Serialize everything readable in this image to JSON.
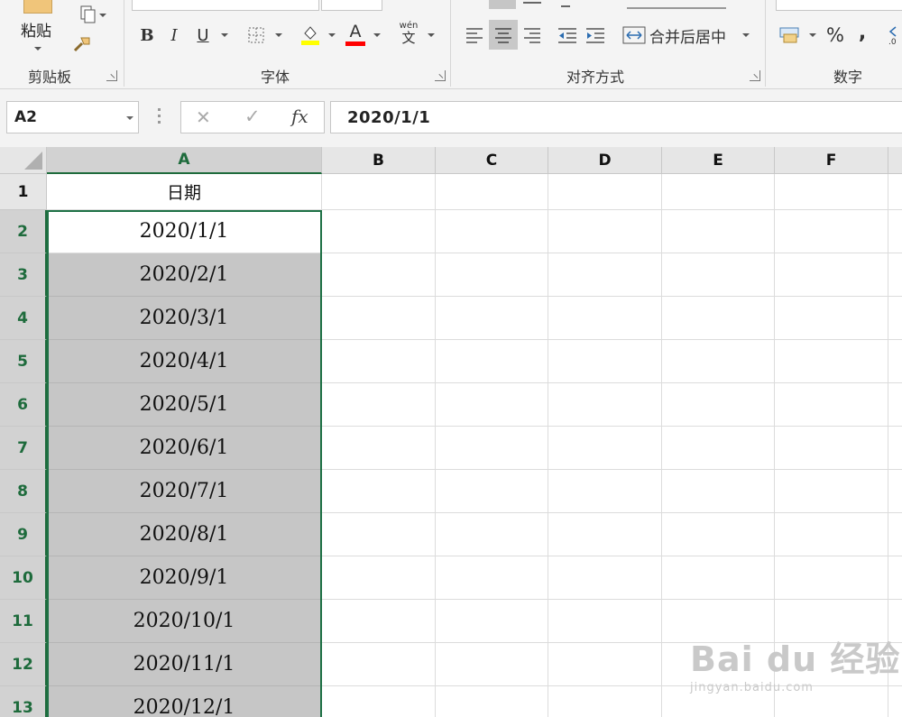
{
  "ribbon": {
    "clipboard": {
      "paste_label": "粘贴",
      "group_label": "剪贴板"
    },
    "font": {
      "group_label": "字体",
      "bold": "B",
      "italic": "I",
      "underline": "U",
      "font_color_letter": "A",
      "phonetic_top": "wén",
      "phonetic_bottom": "文"
    },
    "alignment": {
      "group_label": "对齐方式",
      "merge_center_label": "合并后居中"
    },
    "number": {
      "group_label": "数字",
      "percent": "%",
      "comma": ","
    }
  },
  "formula_bar": {
    "name_box": "A2",
    "fx": "fx",
    "cancel": "✕",
    "enter": "✓",
    "value": "2020/1/1"
  },
  "grid": {
    "columns": [
      "A",
      "B",
      "C",
      "D",
      "E",
      "F"
    ],
    "rows": [
      "1",
      "2",
      "3",
      "4",
      "5",
      "6",
      "7",
      "8",
      "9",
      "10",
      "11",
      "12",
      "13"
    ],
    "column_a": [
      "日期",
      "2020/1/1",
      "2020/2/1",
      "2020/3/1",
      "2020/4/1",
      "2020/5/1",
      "2020/6/1",
      "2020/7/1",
      "2020/8/1",
      "2020/9/1",
      "2020/10/1",
      "2020/11/1",
      "2020/12/1"
    ]
  },
  "watermark": {
    "brand": "Bai du 经验",
    "url": "jingyan.baidu.com"
  },
  "colors": {
    "selection": "#1e7145",
    "selected_fill": "#c6c6c6",
    "font_color_bar": "#ff0000",
    "fill_color_bar": "#ffff00"
  }
}
